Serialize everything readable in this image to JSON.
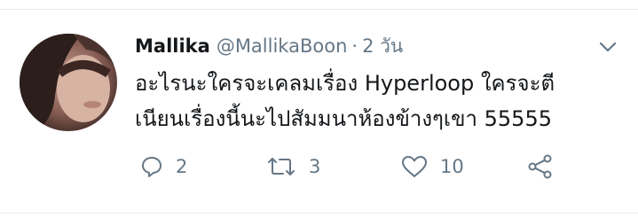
{
  "tweet": {
    "display_name": "Mallika",
    "handle": "@MallikaBoon",
    "separator": "·",
    "timestamp": "2 วัน",
    "text_lines": [
      "อะไรนะใครจะเคลมเรื่อง Hyperloop ใครจะตี",
      "เนียนเรื่องนี้นะไปสัมมนาห้องข้างๆเขา 55555"
    ]
  },
  "actions": {
    "reply_count": "2",
    "retweet_count": "3",
    "like_count": "10"
  },
  "icons": {
    "menu": "chevron-down-icon",
    "reply": "reply-icon",
    "retweet": "retweet-icon",
    "like": "heart-icon",
    "share": "share-icon"
  },
  "colors": {
    "text": "#14171a",
    "secondary": "#657786",
    "icon": "#657786",
    "divider": "#e6ecf0"
  }
}
